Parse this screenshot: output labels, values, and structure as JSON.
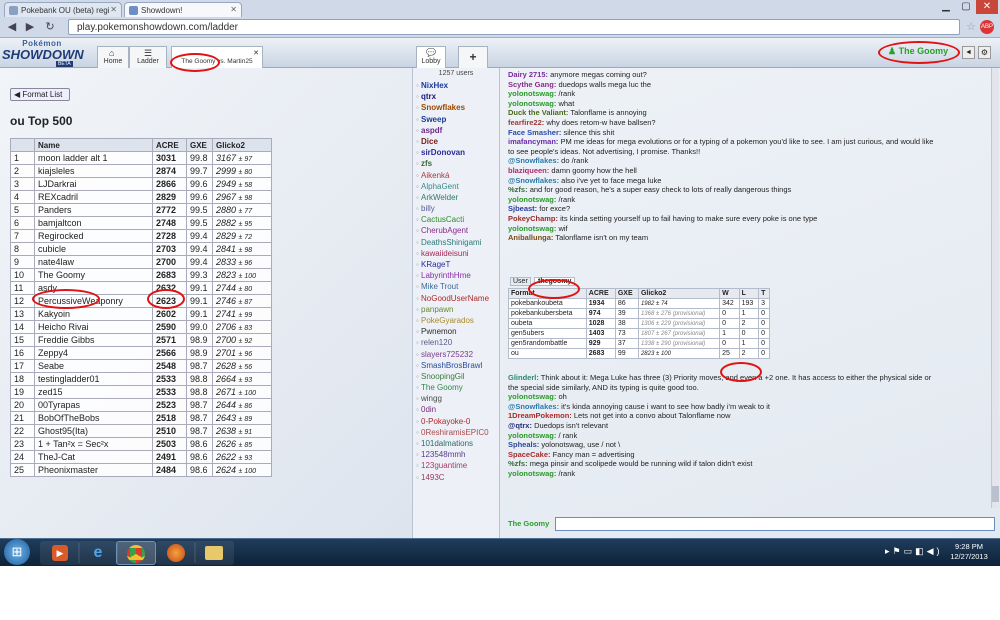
{
  "browser": {
    "tabs": [
      {
        "title": "Pokebank OU (beta) regi",
        "active": false
      },
      {
        "title": "Showdown!",
        "active": true
      }
    ],
    "url": "play.pokemonshowdown.com/ladder"
  },
  "ps": {
    "logo_top": "Pokémon",
    "logo_main": "SHOWDOWN",
    "logo_beta": "BETA",
    "tabs": {
      "home": "Home",
      "ladder": "Ladder",
      "battle": "The Goomy vs. Martin25",
      "lobby": "Lobby",
      "plus": "+"
    },
    "username": "The Goomy",
    "volume": "◄",
    "settings": "⚙"
  },
  "ladder": {
    "back_label": "Format List",
    "title": "ou Top 500",
    "headers": [
      "",
      "Name",
      "ACRE",
      "GXE",
      "Glicko2"
    ],
    "rows": [
      {
        "rank": "1",
        "name": "moon ladder alt 1",
        "acre": "3031",
        "gxe": "99.8",
        "glicko": "3167",
        "dev": "± 97"
      },
      {
        "rank": "2",
        "name": "kiajsleles",
        "acre": "2874",
        "gxe": "99.7",
        "glicko": "2999",
        "dev": "± 80"
      },
      {
        "rank": "3",
        "name": "LJDarkrai",
        "acre": "2866",
        "gxe": "99.6",
        "glicko": "2949",
        "dev": "± 58"
      },
      {
        "rank": "4",
        "name": "REXcadril",
        "acre": "2829",
        "gxe": "99.6",
        "glicko": "2967",
        "dev": "± 98"
      },
      {
        "rank": "5",
        "name": "Panders",
        "acre": "2772",
        "gxe": "99.5",
        "glicko": "2880",
        "dev": "± 77"
      },
      {
        "rank": "6",
        "name": "bamjaltcon",
        "acre": "2748",
        "gxe": "99.5",
        "glicko": "2882",
        "dev": "± 95"
      },
      {
        "rank": "7",
        "name": "Regirocked",
        "acre": "2728",
        "gxe": "99.4",
        "glicko": "2829",
        "dev": "± 72"
      },
      {
        "rank": "8",
        "name": "cubicle",
        "acre": "2703",
        "gxe": "99.4",
        "glicko": "2841",
        "dev": "± 98"
      },
      {
        "rank": "9",
        "name": "nate4law",
        "acre": "2700",
        "gxe": "99.4",
        "glicko": "2833",
        "dev": "± 96"
      },
      {
        "rank": "10",
        "name": "The Goomy",
        "acre": "2683",
        "gxe": "99.3",
        "glicko": "2823",
        "dev": "± 100"
      },
      {
        "rank": "11",
        "name": "asdy",
        "acre": "2632",
        "gxe": "99.1",
        "glicko": "2744",
        "dev": "± 80"
      },
      {
        "rank": "12",
        "name": "PercussiveWeaponry",
        "acre": "2623",
        "gxe": "99.1",
        "glicko": "2746",
        "dev": "± 87"
      },
      {
        "rank": "13",
        "name": "Kakyoin",
        "acre": "2602",
        "gxe": "99.1",
        "glicko": "2741",
        "dev": "± 99"
      },
      {
        "rank": "14",
        "name": "Heicho Rivai",
        "acre": "2590",
        "gxe": "99.0",
        "glicko": "2706",
        "dev": "± 83"
      },
      {
        "rank": "15",
        "name": "Freddie Gibbs",
        "acre": "2571",
        "gxe": "98.9",
        "glicko": "2700",
        "dev": "± 92"
      },
      {
        "rank": "16",
        "name": "Zeppy4",
        "acre": "2566",
        "gxe": "98.9",
        "glicko": "2701",
        "dev": "± 96"
      },
      {
        "rank": "17",
        "name": "Seabe",
        "acre": "2548",
        "gxe": "98.7",
        "glicko": "2628",
        "dev": "± 56"
      },
      {
        "rank": "18",
        "name": "testingladder01",
        "acre": "2533",
        "gxe": "98.8",
        "glicko": "2664",
        "dev": "± 93"
      },
      {
        "rank": "19",
        "name": "zed15",
        "acre": "2533",
        "gxe": "98.8",
        "glicko": "2671",
        "dev": "± 100"
      },
      {
        "rank": "20",
        "name": "00Tyrapas",
        "acre": "2523",
        "gxe": "98.7",
        "glicko": "2644",
        "dev": "± 86"
      },
      {
        "rank": "21",
        "name": "BobOfTheBobs",
        "acre": "2518",
        "gxe": "98.7",
        "glicko": "2643",
        "dev": "± 89"
      },
      {
        "rank": "22",
        "name": "Ghost95(Ita)",
        "acre": "2510",
        "gxe": "98.7",
        "glicko": "2638",
        "dev": "± 91"
      },
      {
        "rank": "23",
        "name": "1 + Tan²x = Sec²x",
        "acre": "2503",
        "gxe": "98.6",
        "glicko": "2626",
        "dev": "± 85"
      },
      {
        "rank": "24",
        "name": "TheJ-Cat",
        "acre": "2491",
        "gxe": "98.6",
        "glicko": "2622",
        "dev": "± 93"
      },
      {
        "rank": "25",
        "name": "Pheonixmaster",
        "acre": "2484",
        "gxe": "98.6",
        "glicko": "2624",
        "dev": "± 100"
      }
    ]
  },
  "userlist": {
    "count": "1257 users",
    "users": [
      {
        "name": "NixHex",
        "color": "#1a3a9a"
      },
      {
        "name": "qtrx",
        "color": "#1a1a7a"
      },
      {
        "name": "Snowflakes",
        "color": "#9a4a00"
      },
      {
        "name": "Sweep",
        "color": "#1a3a9a"
      },
      {
        "name": "aspdf",
        "color": "#6a2a8a"
      },
      {
        "name": "Dice",
        "color": "#7a1a1a"
      },
      {
        "name": "sirDonovan",
        "color": "#2a2a9a"
      },
      {
        "name": "zfs",
        "color": "#3a6a3a"
      },
      {
        "name": "Aikenká",
        "color": "#aa3a3a"
      },
      {
        "name": "AlphaGent",
        "color": "#3a8a8a"
      },
      {
        "name": "ArkWelder",
        "color": "#2a7a6a"
      },
      {
        "name": "billy",
        "color": "#5a5a9a"
      },
      {
        "name": "CactusCacti",
        "color": "#2a8a2a"
      },
      {
        "name": "CherubAgent",
        "color": "#8a2a8a"
      },
      {
        "name": "DeathsShinigami",
        "color": "#2a7a7a"
      },
      {
        "name": "kawaiideisuni",
        "color": "#a02a5a"
      },
      {
        "name": "KRageT",
        "color": "#2a2a9a"
      },
      {
        "name": "LabyrinthHme",
        "color": "#8a2aaa"
      },
      {
        "name": "Mike Trout",
        "color": "#3a6a9a"
      },
      {
        "name": "NoGoodUserName",
        "color": "#aa2a2a"
      },
      {
        "name": "panpawn",
        "color": "#6a8a2a"
      },
      {
        "name": "PokeGyarados",
        "color": "#aa8a2a"
      },
      {
        "name": "Pwnemon",
        "color": "#2a2a2a"
      },
      {
        "name": "relen120",
        "color": "#5a5a8a"
      },
      {
        "name": "slayers725232",
        "color": "#7a3a8a"
      },
      {
        "name": "SmashBrosBrawl",
        "color": "#2a4a9a"
      },
      {
        "name": "SnoopingGil",
        "color": "#3a7a3a"
      },
      {
        "name": "The Goomy",
        "color": "#2a8a4a"
      },
      {
        "name": "wingg",
        "color": "#4a4a4a"
      },
      {
        "name": "0din",
        "color": "#7a2a7a"
      },
      {
        "name": "0-Pokayoke-0",
        "color": "#aa2a2a"
      },
      {
        "name": "0ReshiramisEPIC0",
        "color": "#aa4a4a"
      },
      {
        "name": "101dalmations",
        "color": "#2a6a6a"
      },
      {
        "name": "123548mmh",
        "color": "#5a3a8a"
      },
      {
        "name": "123guantime",
        "color": "#aa3a6a"
      },
      {
        "name": "1493C",
        "color": "#9a3a5a"
      }
    ]
  },
  "chat": {
    "lines": [
      {
        "user": "Dairy 2715:",
        "color": "#7a2a9a",
        "text": "anymore megas coming out?"
      },
      {
        "user": "Scythe Gang:",
        "color": "#8a2a8a",
        "text": "duedops walls mega luc the"
      },
      {
        "user": "yolonotswag:",
        "color": "#2a9a2a",
        "text": "/rank"
      },
      {
        "user": "yolonotswag:",
        "color": "#2a9a2a",
        "text": "what"
      },
      {
        "user": "Duck the Valiant:",
        "color": "#4a6a1a",
        "text": "Talonflame is annoying"
      },
      {
        "user": "fearfire22:",
        "color": "#9a3a3a",
        "text": "why does retom-w have ballsen?"
      },
      {
        "user": "Face Smasher:",
        "color": "#2a4aaa",
        "text": "silence this shit"
      },
      {
        "user": "imafancyman:",
        "color": "#6a2aaa",
        "text": "PM me ideas for mega evolutions or for a typing of a pokemon you'd like to see. I am just curious, and would like"
      },
      {
        "user": "",
        "color": "#444",
        "text": "to see people's ideas. Not advertising, I promise. Thanks!!"
      },
      {
        "user": "@Snowflakes:",
        "color": "#2a7aaa",
        "text": "do /rank"
      },
      {
        "user": "blaziqueen:",
        "color": "#aa2a6a",
        "text": "damn goomy how the hell"
      },
      {
        "user": "@Snowflakes:",
        "color": "#2a7aaa",
        "text": "also i've yet to face mega luke"
      },
      {
        "user": "%zfs:",
        "color": "#3a6a3a",
        "text": "and for good reason, he's a super easy check to lots of really dangerous things"
      },
      {
        "user": "yolonotswag:",
        "color": "#2a9a2a",
        "text": "/rank"
      },
      {
        "user": "Sjbeast:",
        "color": "#2a3a9a",
        "text": "for exce?"
      },
      {
        "user": "PokeyChamp:",
        "color": "#9a2a2a",
        "text": "its kinda setting yourself up to fail having to make sure every poke is one type"
      },
      {
        "user": "yolonotswag:",
        "color": "#2a9a2a",
        "text": "wif"
      },
      {
        "user": "Aniballunga:",
        "color": "#7a4a1a",
        "text": "Talonflame isn't on my team"
      }
    ],
    "lines_after": [
      {
        "user": "Glinderl:",
        "color": "#2a8a6a",
        "text": "Think about it: Mega Luke has three (3) Priority moves, and even a +2 one. It has access to either the physical side or"
      },
      {
        "user": "",
        "color": "#444",
        "text": "the special side similarly, AND its typing is quite good too."
      },
      {
        "user": "yolonotswag:",
        "color": "#2a9a2a",
        "text": "oh"
      },
      {
        "user": "@Snowflakes:",
        "color": "#2a7aaa",
        "text": "it's kinda annoying cause i want to see how badly i'm weak to it"
      },
      {
        "user": "1DreamPokemon:",
        "color": "#aa2a2a",
        "text": "Lets not get into a convo about Talonflame now"
      },
      {
        "user": "@qtrx:",
        "color": "#2a2a7a",
        "text": "Duedops isn't relevant"
      },
      {
        "user": "yolonotswag:",
        "color": "#2a9a2a",
        "text": "/ rank"
      },
      {
        "user": "Spheals:",
        "color": "#2a4a9a",
        "text": "yolonotswag, use / not \\"
      },
      {
        "user": "SpaceCake:",
        "color": "#aa2a2a",
        "text": "Fancy man = advertising"
      },
      {
        "user": "%zfs:",
        "color": "#3a6a3a",
        "text": "mega pinsir and scolipede would be running wild if talon didn't exist"
      },
      {
        "user": "yolonotswag:",
        "color": "#2a9a2a",
        "text": "/rank"
      }
    ],
    "input_user": "The Goomy",
    "input_value": ""
  },
  "rankbox": {
    "tab_user": "User",
    "tab_name": "thegoomy",
    "headers": [
      "Format",
      "ACRE",
      "GXE",
      "Glicko2",
      "W",
      "L",
      "T"
    ],
    "rows": [
      {
        "format": "pokebankoubeta",
        "acre": "1934",
        "gxe": "86",
        "glicko": "1982 ± 74",
        "w": "342",
        "l": "193",
        "t": "3"
      },
      {
        "format": "pokebankubersbeta",
        "acre": "974",
        "gxe": "39",
        "glicko": "1368 ± 276 (provisional)",
        "w": "0",
        "l": "1",
        "t": "0"
      },
      {
        "format": "oubeta",
        "acre": "1028",
        "gxe": "38",
        "glicko": "1306 ± 229 (provisional)",
        "w": "0",
        "l": "2",
        "t": "0"
      },
      {
        "format": "gen5ubers",
        "acre": "1403",
        "gxe": "73",
        "glicko": "1807 ± 267 (provisional)",
        "w": "1",
        "l": "0",
        "t": "0"
      },
      {
        "format": "gen5randombattle",
        "acre": "929",
        "gxe": "37",
        "glicko": "1338 ± 290 (provisional)",
        "w": "0",
        "l": "1",
        "t": "0"
      },
      {
        "format": "ou",
        "acre": "2683",
        "gxe": "99",
        "glicko": "2823 ± 100",
        "w": "25",
        "l": "2",
        "t": "0"
      }
    ]
  },
  "taskbar": {
    "time": "9:28 PM",
    "date": "12/27/2013"
  },
  "colors": {
    "ps_green": "#2aa02a",
    "annotation_red": "#e01212"
  }
}
